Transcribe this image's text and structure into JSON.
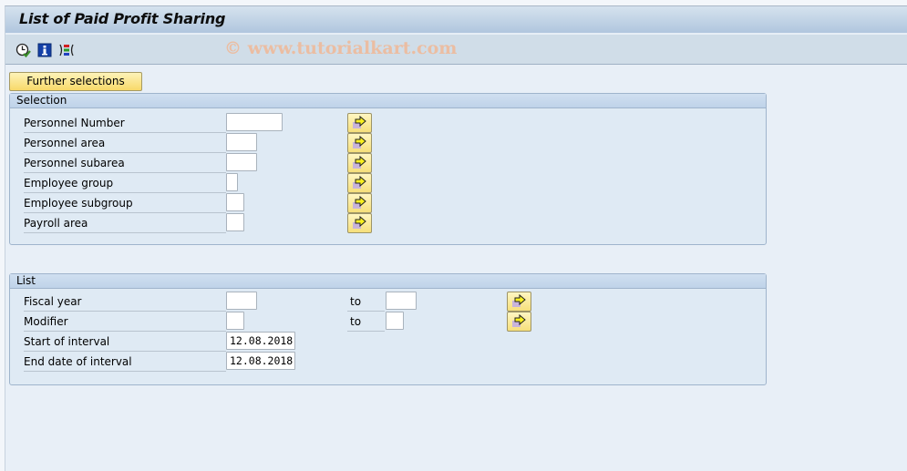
{
  "window": {
    "title": "List of Paid Profit Sharing"
  },
  "toolbar": {
    "icons": [
      {
        "name": "execute-icon",
        "tooltip": "Execute"
      },
      {
        "name": "info-icon",
        "tooltip": "Information"
      },
      {
        "name": "selection-options-icon",
        "tooltip": "Selection options"
      }
    ],
    "watermark": "© www.tutorialkart.com"
  },
  "further_selections_label": "Further selections",
  "selection": {
    "title": "Selection",
    "fields": [
      {
        "label": "Personnel Number",
        "value": ""
      },
      {
        "label": "Personnel area",
        "value": ""
      },
      {
        "label": "Personnel subarea",
        "value": ""
      },
      {
        "label": "Employee group",
        "value": ""
      },
      {
        "label": "Employee subgroup",
        "value": ""
      },
      {
        "label": "Payroll area",
        "value": ""
      }
    ]
  },
  "list": {
    "title": "List",
    "fields": [
      {
        "label": "Fiscal year",
        "value": "",
        "to_label": "to",
        "to_value": ""
      },
      {
        "label": "Modifier",
        "value": "",
        "to_label": "to",
        "to_value": ""
      },
      {
        "label": "Start of interval",
        "value": "12.08.2018"
      },
      {
        "label": "End date of interval",
        "value": "12.08.2018"
      }
    ]
  }
}
